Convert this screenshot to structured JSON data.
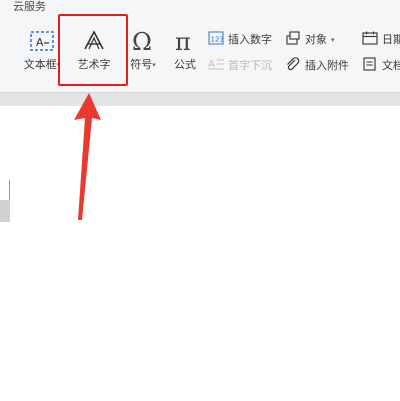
{
  "ribbon": {
    "tab_label": "云服务",
    "textbox": {
      "label": "文本框",
      "icon": "textbox-icon"
    },
    "wordart": {
      "label": "艺术字",
      "icon": "wordart-icon"
    },
    "symbol": {
      "label": "符号",
      "icon": "omega-icon"
    },
    "formula": {
      "label": "公式",
      "icon": "pi-icon"
    },
    "insert_number": {
      "label": "插入数字",
      "icon": "number-icon"
    },
    "drop_cap": {
      "label": "首字下沉",
      "icon": "drop-cap-icon",
      "enabled": false
    },
    "object": {
      "label": "对象",
      "icon": "object-icon"
    },
    "attachment": {
      "label": "插入附件",
      "icon": "paperclip-icon"
    },
    "date": {
      "label": "日期",
      "icon": "calendar-icon"
    },
    "doc": {
      "label": "文档",
      "icon": "document-icon"
    }
  },
  "annotation": {
    "color": "#e02020",
    "target": "wordart"
  }
}
